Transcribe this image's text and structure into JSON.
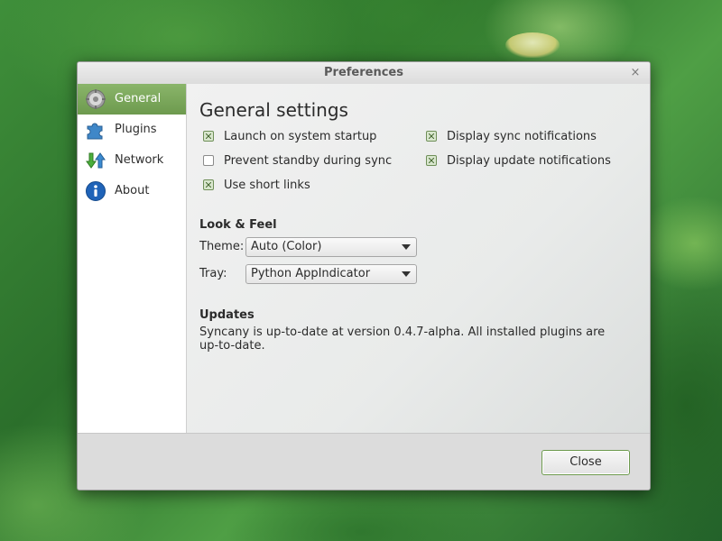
{
  "window": {
    "title": "Preferences",
    "close_glyph": "×"
  },
  "sidebar": {
    "items": [
      {
        "label": "General",
        "icon": "gear-icon",
        "selected": true
      },
      {
        "label": "Plugins",
        "icon": "puzzle-piece-icon",
        "selected": false
      },
      {
        "label": "Network",
        "icon": "transfer-arrows-icon",
        "selected": false
      },
      {
        "label": "About",
        "icon": "info-icon",
        "selected": false
      }
    ]
  },
  "general": {
    "heading": "General settings",
    "options": [
      {
        "label": "Launch on system startup",
        "checked": true
      },
      {
        "label": "Prevent standby during sync",
        "checked": false
      },
      {
        "label": "Use short links",
        "checked": true
      },
      {
        "label": "Display sync notifications",
        "checked": true
      },
      {
        "label": "Display update notifications",
        "checked": true
      }
    ],
    "look_and_feel": {
      "title": "Look & Feel",
      "theme_label": "Theme:",
      "theme_value": "Auto (Color)",
      "tray_label": "Tray:",
      "tray_value": "Python AppIndicator"
    },
    "updates": {
      "title": "Updates",
      "text": "Syncany is up-to-date at version 0.4.7-alpha. All installed plugins are up-to-date."
    }
  },
  "buttons": {
    "close_label": "Close"
  },
  "colors": {
    "accent": "#7ba75b",
    "selected_text": "#ffffff",
    "text": "#2b2b2b"
  }
}
